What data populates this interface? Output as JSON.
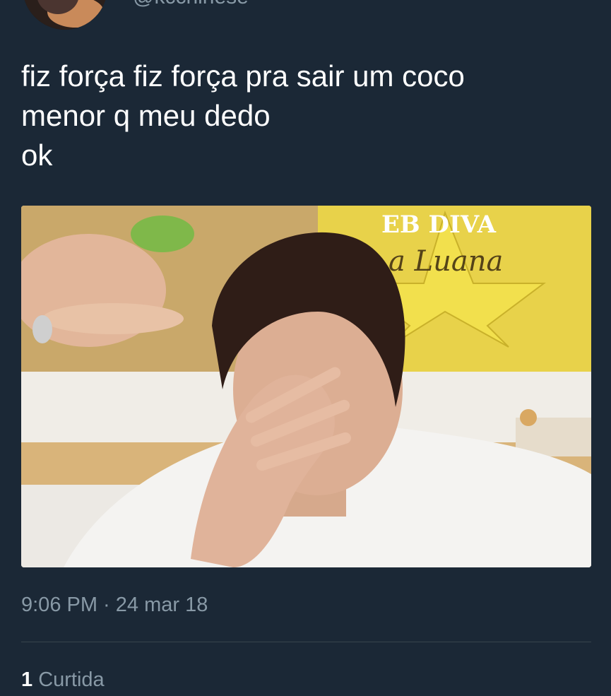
{
  "user": {
    "handle": "@kcchinese"
  },
  "tweet": {
    "lines": [
      "fiz força fiz força pra sair um coco",
      "menor q meu dedo",
      "ok"
    ],
    "image_text": "WEB DIVA Luana",
    "timestamp": "9:06 PM · 24 mar 18",
    "likes_count": "1",
    "likes_label": "Curtida"
  },
  "colors": {
    "background": "#1b2836",
    "secondary_text": "#8899a6",
    "divider": "#38444d"
  }
}
